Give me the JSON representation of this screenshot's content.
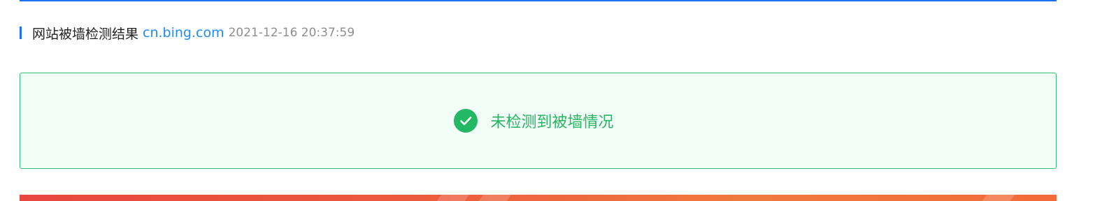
{
  "header": {
    "title": "网站被墙检测结果",
    "domain": "cn.bing.com",
    "timestamp": "2021-12-16 20:37:59"
  },
  "result": {
    "status_text": "未检测到被墙情况",
    "icon": "check-circle-icon"
  },
  "colors": {
    "accent_blue": "#1f6fff",
    "link_blue": "#1d8cf8",
    "success_green": "#28b463",
    "success_bg": "#f3fdf7",
    "banner_red": "#e8473f",
    "banner_orange": "#f07a3e"
  }
}
